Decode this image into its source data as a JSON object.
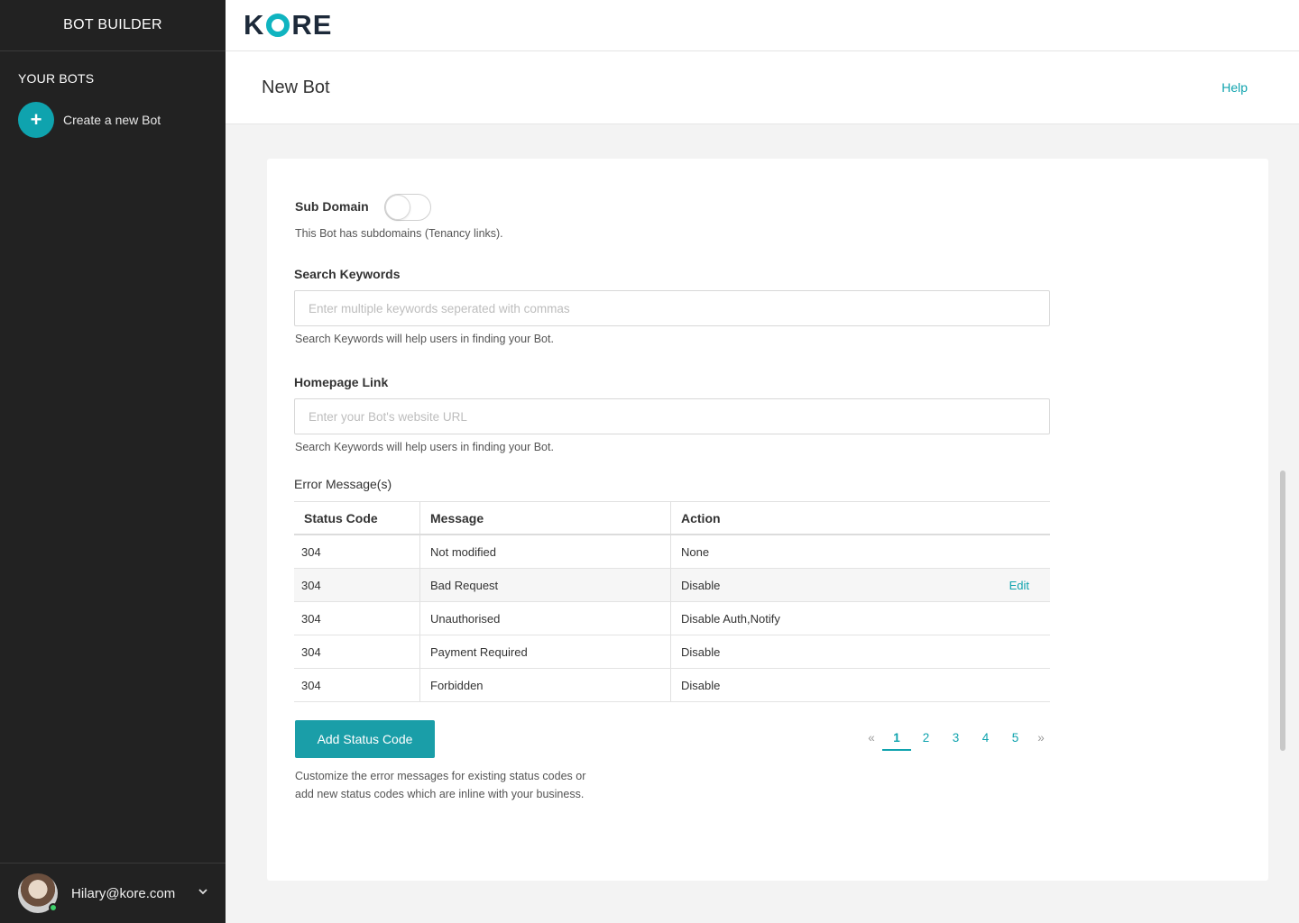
{
  "sidebar": {
    "title": "BOT BUILDER",
    "section": "YOUR BOTS",
    "create_label": "Create a new Bot",
    "create_icon": "+",
    "user_email": "Hilary@kore.com"
  },
  "topbar": {
    "logo_left": "K",
    "logo_right": "RE"
  },
  "page": {
    "title": "New Bot",
    "help": "Help"
  },
  "form": {
    "subdomain_label": "Sub Domain",
    "subdomain_hint": "This Bot has subdomains (Tenancy links).",
    "subdomain_enabled": false,
    "keywords_label": "Search Keywords",
    "keywords_placeholder": "Enter multiple keywords seperated with commas",
    "keywords_value": "",
    "keywords_hint": "Search Keywords will help users in finding your Bot.",
    "homepage_label": "Homepage Link",
    "homepage_placeholder": "Enter your Bot's website URL",
    "homepage_value": "",
    "homepage_hint": "Search Keywords will help users in finding your Bot."
  },
  "errors": {
    "title": "Error Message(s)",
    "columns": [
      "Status Code",
      "Message",
      "Action"
    ],
    "rows": [
      {
        "code": "304",
        "message": "Not modified",
        "action": "None",
        "edit": ""
      },
      {
        "code": "304",
        "message": "Bad Request",
        "action": "Disable",
        "edit": "Edit"
      },
      {
        "code": "304",
        "message": "Unauthorised",
        "action": "Disable Auth,Notify",
        "edit": ""
      },
      {
        "code": "304",
        "message": "Payment Required",
        "action": "Disable",
        "edit": ""
      },
      {
        "code": "304",
        "message": "Forbidden",
        "action": "Disable",
        "edit": ""
      }
    ],
    "add_button": "Add Status Code",
    "footnote_line1": "Customize the error messages for existing status codes or",
    "footnote_line2": "add new status codes which are inline with your business."
  },
  "pagination": {
    "prev": "«",
    "next": "»",
    "pages": [
      "1",
      "2",
      "3",
      "4",
      "5"
    ],
    "current": "1"
  },
  "colors": {
    "accent": "#0fa3ae",
    "sidebar_bg": "#222222",
    "button_bg": "#1a9ea8"
  }
}
